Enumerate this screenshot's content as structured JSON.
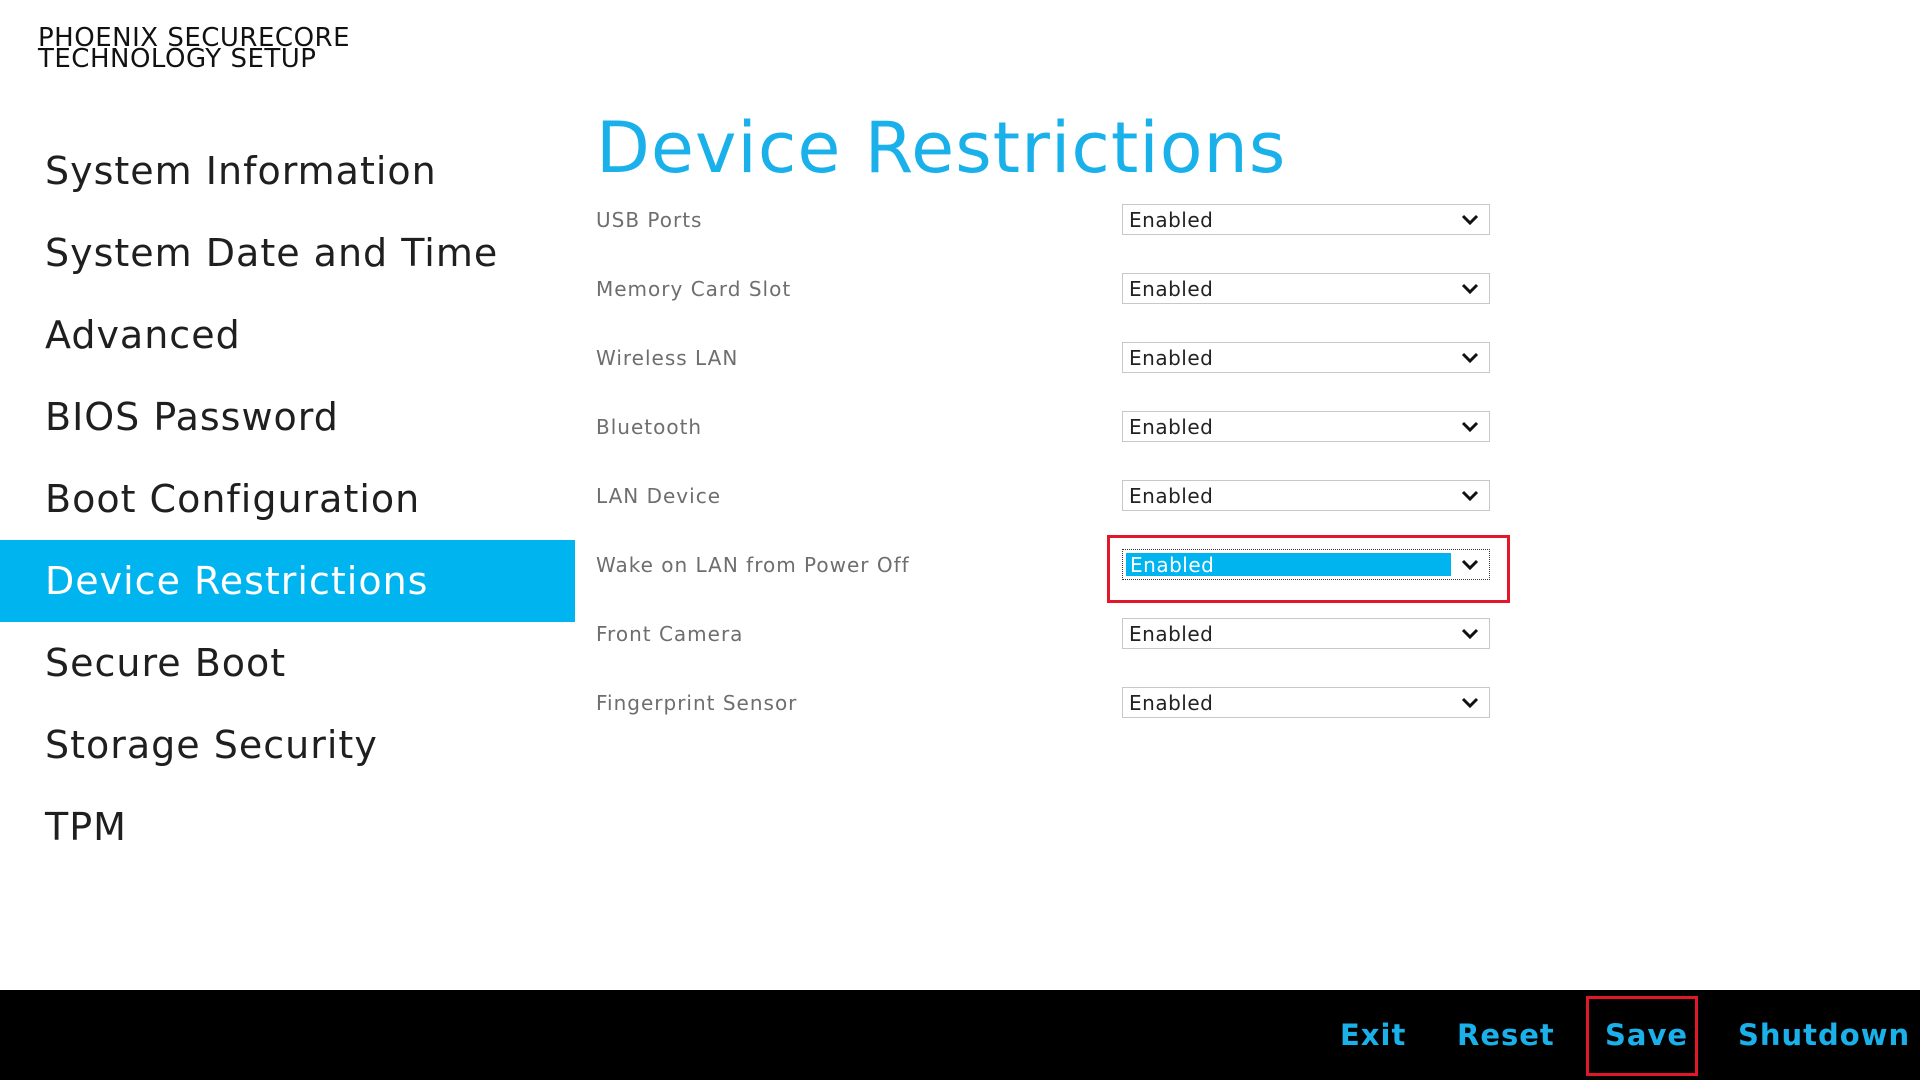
{
  "brand": {
    "line1": "PHOENIX SECURECORE",
    "line2": "TECHNOLOGY SETUP"
  },
  "sidebar": {
    "items": [
      {
        "label": "System Information"
      },
      {
        "label": "System Date and Time"
      },
      {
        "label": "Advanced"
      },
      {
        "label": "BIOS Password"
      },
      {
        "label": "Boot Configuration"
      },
      {
        "label": "Device Restrictions"
      },
      {
        "label": "Secure Boot"
      },
      {
        "label": "Storage Security"
      },
      {
        "label": "TPM"
      }
    ],
    "active": "Device Restrictions"
  },
  "main": {
    "title": "Device Restrictions",
    "settings": [
      {
        "label": "USB Ports",
        "value": "Enabled"
      },
      {
        "label": "Memory Card Slot",
        "value": "Enabled"
      },
      {
        "label": "Wireless LAN",
        "value": "Enabled"
      },
      {
        "label": "Bluetooth",
        "value": "Enabled"
      },
      {
        "label": "LAN Device",
        "value": "Enabled"
      },
      {
        "label": "Wake on LAN from Power Off",
        "value": "Enabled"
      },
      {
        "label": "Front Camera",
        "value": "Enabled"
      },
      {
        "label": "Fingerprint Sensor",
        "value": "Enabled"
      }
    ],
    "focused_setting": "Wake on LAN from Power Off"
  },
  "footer": {
    "exit": "Exit",
    "reset": "Reset",
    "save": "Save",
    "shutdown": "Shutdown"
  },
  "colors": {
    "accent": "#00b4f0",
    "title": "#1ab1eb",
    "highlight_border": "#e1182a",
    "footer_bg": "#000000"
  },
  "icons": {
    "dropdown": "chevron-down-icon"
  }
}
